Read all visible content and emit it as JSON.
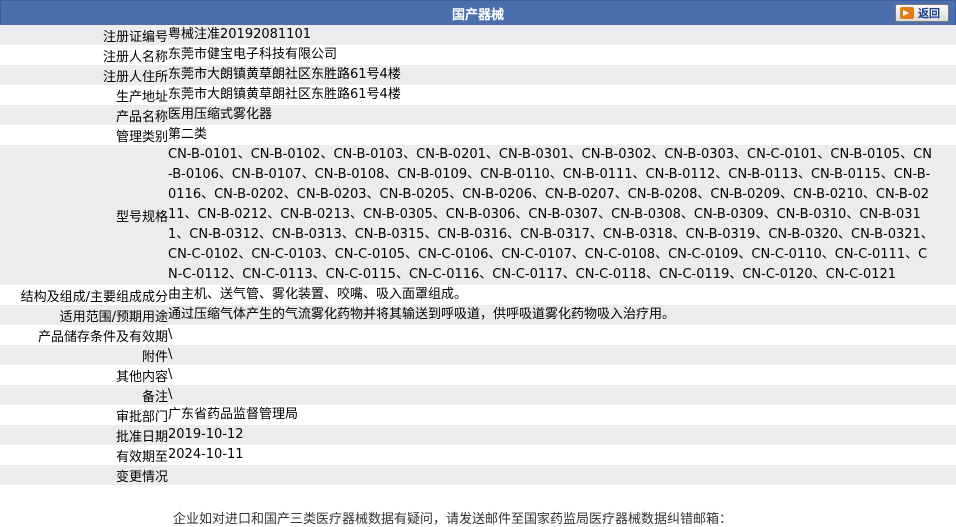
{
  "header": {
    "title": "国产器械",
    "back_label": "返回"
  },
  "rows": [
    {
      "label": "注册证编号",
      "value": "粤械注准20192081101"
    },
    {
      "label": "注册人名称",
      "value": "东莞市健宝电子科技有限公司"
    },
    {
      "label": "注册人住所",
      "value": "东莞市大朗镇黄草朗社区东胜路61号4楼"
    },
    {
      "label": "生产地址",
      "value": "东莞市大朗镇黄草朗社区东胜路61号4楼"
    },
    {
      "label": "产品名称",
      "value": "医用压缩式雾化器"
    },
    {
      "label": "管理类别",
      "value": "第二类"
    },
    {
      "label": "型号规格",
      "value": "CN-B-0101、CN-B-0102、CN-B-0103、CN-B-0201、CN-B-0301、CN-B-0302、CN-B-0303、CN-C-0101、CN-B-0105、CN-B-0106、CN-B-0107、CN-B-0108、CN-B-0109、CN-B-0110、CN-B-0111、CN-B-0112、CN-B-0113、CN-B-0115、CN-B-0116、CN-B-0202、CN-B-0203、CN-B-0205、CN-B-0206、CN-B-0207、CN-B-0208、CN-B-0209、CN-B-0210、CN-B-0211、CN-B-0212、CN-B-0213、CN-B-0305、CN-B-0306、CN-B-0307、CN-B-0308、CN-B-0309、CN-B-0310、CN-B-0311、CN-B-0312、CN-B-0313、CN-B-0315、CN-B-0316、CN-B-0317、CN-B-0318、CN-B-0319、CN-B-0320、CN-B-0321、CN-C-0102、CN-C-0103、CN-C-0105、CN-C-0106、CN-C-0107、CN-C-0108、CN-C-0109、CN-C-0110、CN-C-0111、CN-C-0112、CN-C-0113、CN-C-0115、CN-C-0116、CN-C-0117、CN-C-0118、CN-C-0119、CN-C-0120、CN-C-0121"
    },
    {
      "label": "结构及组成/主要组成成分",
      "value": "由主机、送气管、雾化装置、咬嘴、吸入面罩组成。"
    },
    {
      "label": "适用范围/预期用途",
      "value": "通过压缩气体产生的气流雾化药物并将其输送到呼吸道，供呼吸道雾化药物吸入治疗用。"
    },
    {
      "label": "产品储存条件及有效期",
      "value": "\\"
    },
    {
      "label": "附件",
      "value": "\\"
    },
    {
      "label": "其他内容",
      "value": "\\"
    },
    {
      "label": "备注",
      "value": "\\"
    },
    {
      "label": "审批部门",
      "value": "广东省药品监督管理局"
    },
    {
      "label": "批准日期",
      "value": "2019-10-12"
    },
    {
      "label": "有效期至",
      "value": "2024-10-11"
    },
    {
      "label": "变更情况",
      "value": ""
    }
  ],
  "footer_note": "企业如对进口和国产三类医疗器械数据有疑问，请发送邮件至国家药监局医疗器械数据纠错邮箱：",
  "colors": {
    "header_bg": "#4b6fae",
    "row_alt_bg": "#ececec",
    "back_icon": "#e57c12"
  }
}
